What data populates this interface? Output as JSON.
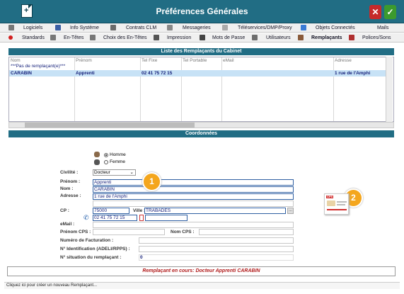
{
  "window": {
    "title": "Préférences Générales",
    "close_icon": "close-icon",
    "validate_icon": "checkmark-icon"
  },
  "tabs_row1": [
    {
      "label": "Logiciels",
      "icon": "W-icon"
    },
    {
      "label": "Info Système",
      "icon": "info-icon"
    },
    {
      "label": "Contrats CLM",
      "icon": "pen-icon"
    },
    {
      "label": "Messageries",
      "icon": "mail-icon"
    },
    {
      "label": "Téléservices/DMP/Proxy",
      "icon": "network-icon"
    },
    {
      "label": "Objets Connectés",
      "icon": "wifi-icon"
    },
    {
      "label": "Mails",
      "icon": "envelope-icon"
    }
  ],
  "tabs_row2": [
    {
      "label": "Standards",
      "icon": "red-dot-icon"
    },
    {
      "label": "En-Têtes",
      "icon": "document-icon"
    },
    {
      "label": "Choix des En-Têtes",
      "icon": "document-list-icon"
    },
    {
      "label": "Impression",
      "icon": "printer-icon"
    },
    {
      "label": "Mots de Passe",
      "icon": "lock-icon"
    },
    {
      "label": "Utilisateurs",
      "icon": "users-icon"
    },
    {
      "label": "Remplaçants",
      "icon": "substitute-icon",
      "active": true
    },
    {
      "label": "Polices/Sons",
      "icon": "font-icon"
    }
  ],
  "list": {
    "title": "Liste des Remplaçants du Cabinet",
    "columns": [
      "Nom",
      "Prénom",
      "Tel Fixe",
      "Tel Portable",
      "eMail",
      "Adresse"
    ],
    "rows": [
      [
        "***Pas de remplaçant(e)***",
        "",
        "",
        "",
        "",
        ""
      ],
      [
        "CARABIN",
        "Apprenti",
        "02 41 75 72 15",
        "",
        "",
        "1 rue de l'Amphi"
      ]
    ]
  },
  "coordonnees": {
    "title": "Coordonnées",
    "gender": {
      "male": "Homme",
      "female": "Femme",
      "selected": "Homme"
    },
    "civilite_label": "Civilité :",
    "civilite_value": "Docteur",
    "prenom_label": "Prénom :",
    "prenom_value": "Apprenti",
    "nom_label": "Nom :",
    "nom_value": "CARABIN",
    "adresse_label": "Adresse :",
    "adresse_value": "1 rue de l'Amphi",
    "cp_label": "CP :",
    "cp_value": "75000",
    "ville_label": "Ville :",
    "ville_value": "TRABADES",
    "phone_value": "02 41 75 72 15",
    "email_label": "eMail :",
    "prenom_cps_label": "Prénom CPS :",
    "nom_cps_label": "Nom CPS :",
    "facturation_label": "Numéro de Facturation :",
    "identification_label": "N° Identification (ADELI/RPPS) :",
    "situation_label": "N° situation du remplaçant :",
    "situation_value": "0"
  },
  "badges": [
    "1",
    "2"
  ],
  "card": {
    "label": "CPS"
  },
  "status_text": "Remplaçant en cours: Docteur Apprenti CARABIN",
  "hint_text": "Cliquez ici pour créer un nouveau Remplaçant..."
}
